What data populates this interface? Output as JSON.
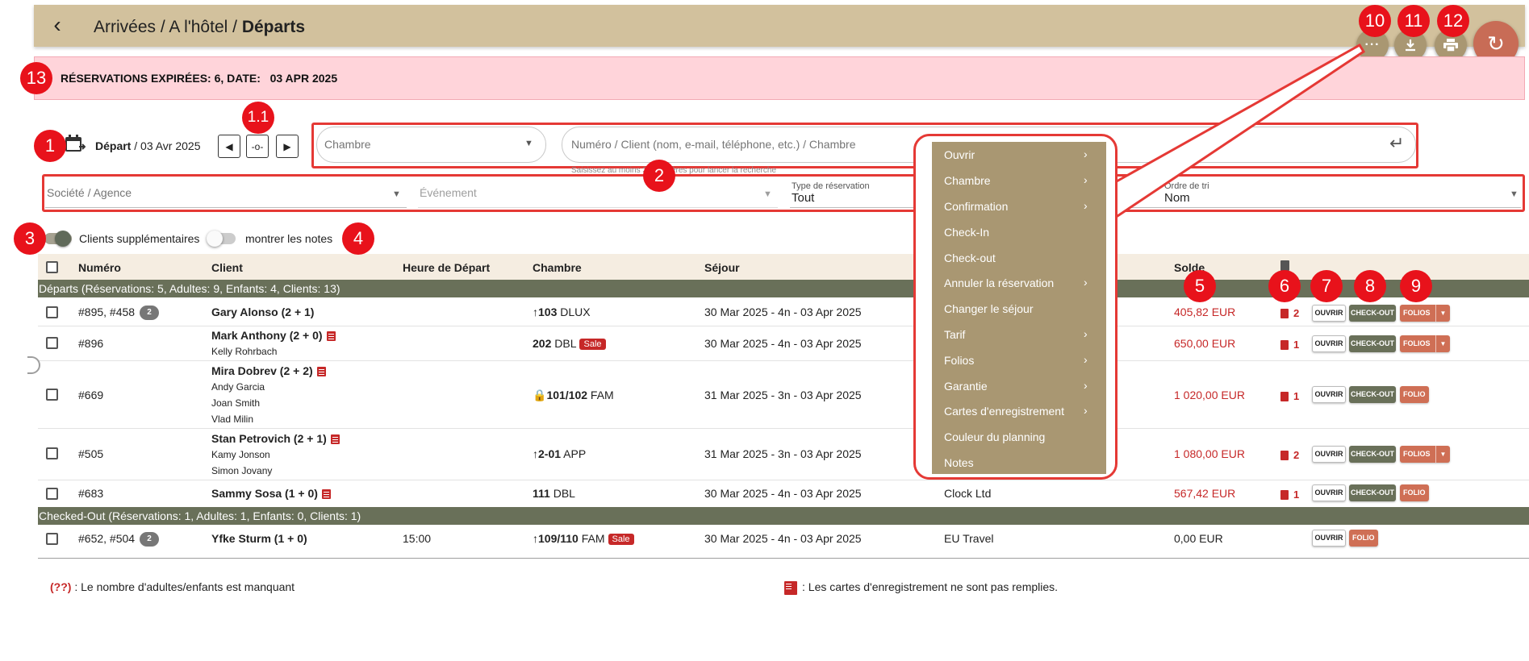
{
  "header": {
    "back_icon": "arrow-back-icon",
    "crumb1": "Arrivées",
    "crumb2": "A l'hôtel",
    "crumb3": "Départs",
    "more_label": "···",
    "colors": {
      "bar": "#d2c19d",
      "button": "#a99772",
      "refresh": "#c86c56"
    }
  },
  "alert": {
    "text": "RÉSERVATIONS EXPIRÉES: 6, DATE:   03 APR 2025"
  },
  "dates": {
    "label_prefix": "Départ",
    "label_date": " / 03 Avr 2025"
  },
  "search": {
    "room_placeholder": "Chambre",
    "query_placeholder": "Numéro / Client (nom, e-mail, téléphone, etc.) / Chambre",
    "hint": "Saisissez au moins 3 caractères pour lancer la recherche"
  },
  "filters": {
    "company_placeholder": "Société / Agence",
    "event_placeholder": "Événement",
    "type_label": "Type de réservation",
    "type_value": "Tout",
    "sort_label": "Ordre de tri",
    "sort_value": "Nom"
  },
  "toggles": {
    "extra_clients": "Clients supplémentaires",
    "show_notes": "montrer les notes"
  },
  "table": {
    "headers": {
      "number": "Numéro",
      "client": "Client",
      "departure_time": "Heure de Départ",
      "room": "Chambre",
      "stay": "Séjour",
      "balance": "Solde"
    },
    "group1": "Départs (Réservations: 5, Adultes: 9, Enfants: 4, Clients: 13)",
    "group2": "Checked-Out (Réservations: 1, Adultes: 1, Enfants: 0, Clients: 1)",
    "rows": [
      {
        "number": "#895, #458",
        "badge": "2",
        "client": "Gary Alonso (2 + 1)",
        "room_num": "103",
        "room_type": " DLUX",
        "stay": "30 Mar 2025 - 4n - 03 Apr 2025",
        "company": "",
        "balance": "405,82 EUR",
        "docs": "2",
        "folio": "FOLIOS"
      },
      {
        "number": "#896",
        "client": "Mark Anthony (2 + 0)",
        "guest1": "Kelly Rohrbach",
        "room_num": "202",
        "room_type": " DBL",
        "sale": "Sale",
        "stay": "30 Mar 2025 - 4n - 03 Apr 2025",
        "balance": "650,00 EUR",
        "docs": "1",
        "folio": "FOLIOS"
      },
      {
        "number": "#669",
        "client": "Mira Dobrev (2 + 2)",
        "guest1": "Andy Garcia",
        "guest2": "Joan Smith",
        "guest3": "Vlad Milin",
        "room_num": "101/102",
        "room_type": " FAM",
        "stay": "31 Mar 2025 - 3n - 03 Apr 2025",
        "balance": "1 020,00 EUR",
        "docs": "1",
        "folio": "FOLIO"
      },
      {
        "number": "#505",
        "client": "Stan Petrovich (2 + 1)",
        "guest1": "Kamy Jonson",
        "guest2": "Simon Jovany",
        "room_num": "2-01",
        "room_type": " APP",
        "stay": "31 Mar 2025 - 3n - 03 Apr 2025",
        "balance": "1 080,00 EUR",
        "docs": "2",
        "folio": "FOLIOS"
      },
      {
        "number": "#683",
        "client": "Sammy Sosa (1 + 0)",
        "room_num": "111",
        "room_type": " DBL",
        "stay": "30 Mar 2025 - 4n - 03 Apr 2025",
        "company": "Clock Ltd",
        "balance": "567,42 EUR",
        "docs": "1",
        "folio": "FOLIO"
      },
      {
        "number": "#652, #504",
        "badge": "2",
        "client": "Yfke Sturm (1 + 0)",
        "time": "15:00",
        "room_num": "109/110",
        "room_type": " FAM",
        "sale": "Sale",
        "stay": "30 Mar 2025 - 4n - 03 Apr 2025",
        "company": "EU Travel",
        "balance": "0,00 EUR",
        "folio": "FOLIO"
      }
    ],
    "btn_open": "OUVRIR",
    "btn_checkout": "CHECK-OUT"
  },
  "legend": {
    "missing_code": "(??)",
    "missing_text": " : Le nombre d'adultes/enfants est manquant",
    "cards_text": ": Les cartes d'enregistrement ne sont pas remplies."
  },
  "menu": {
    "items": [
      "Ouvrir",
      "Chambre",
      "Confirmation",
      "Check-In",
      "Check-out",
      "Annuler la réservation",
      "Changer le séjour",
      "Tarif",
      "Folios",
      "Garantie",
      "Cartes d'enregistrement",
      "Couleur du planning",
      "Notes"
    ],
    "has_submenu": [
      true,
      true,
      true,
      false,
      false,
      true,
      false,
      true,
      true,
      true,
      true,
      false,
      false
    ],
    "color": "#a99772"
  },
  "callouts": [
    "1",
    "1.1",
    "2",
    "3",
    "4",
    "5",
    "6",
    "7",
    "8",
    "9",
    "10",
    "11",
    "12",
    "13"
  ]
}
